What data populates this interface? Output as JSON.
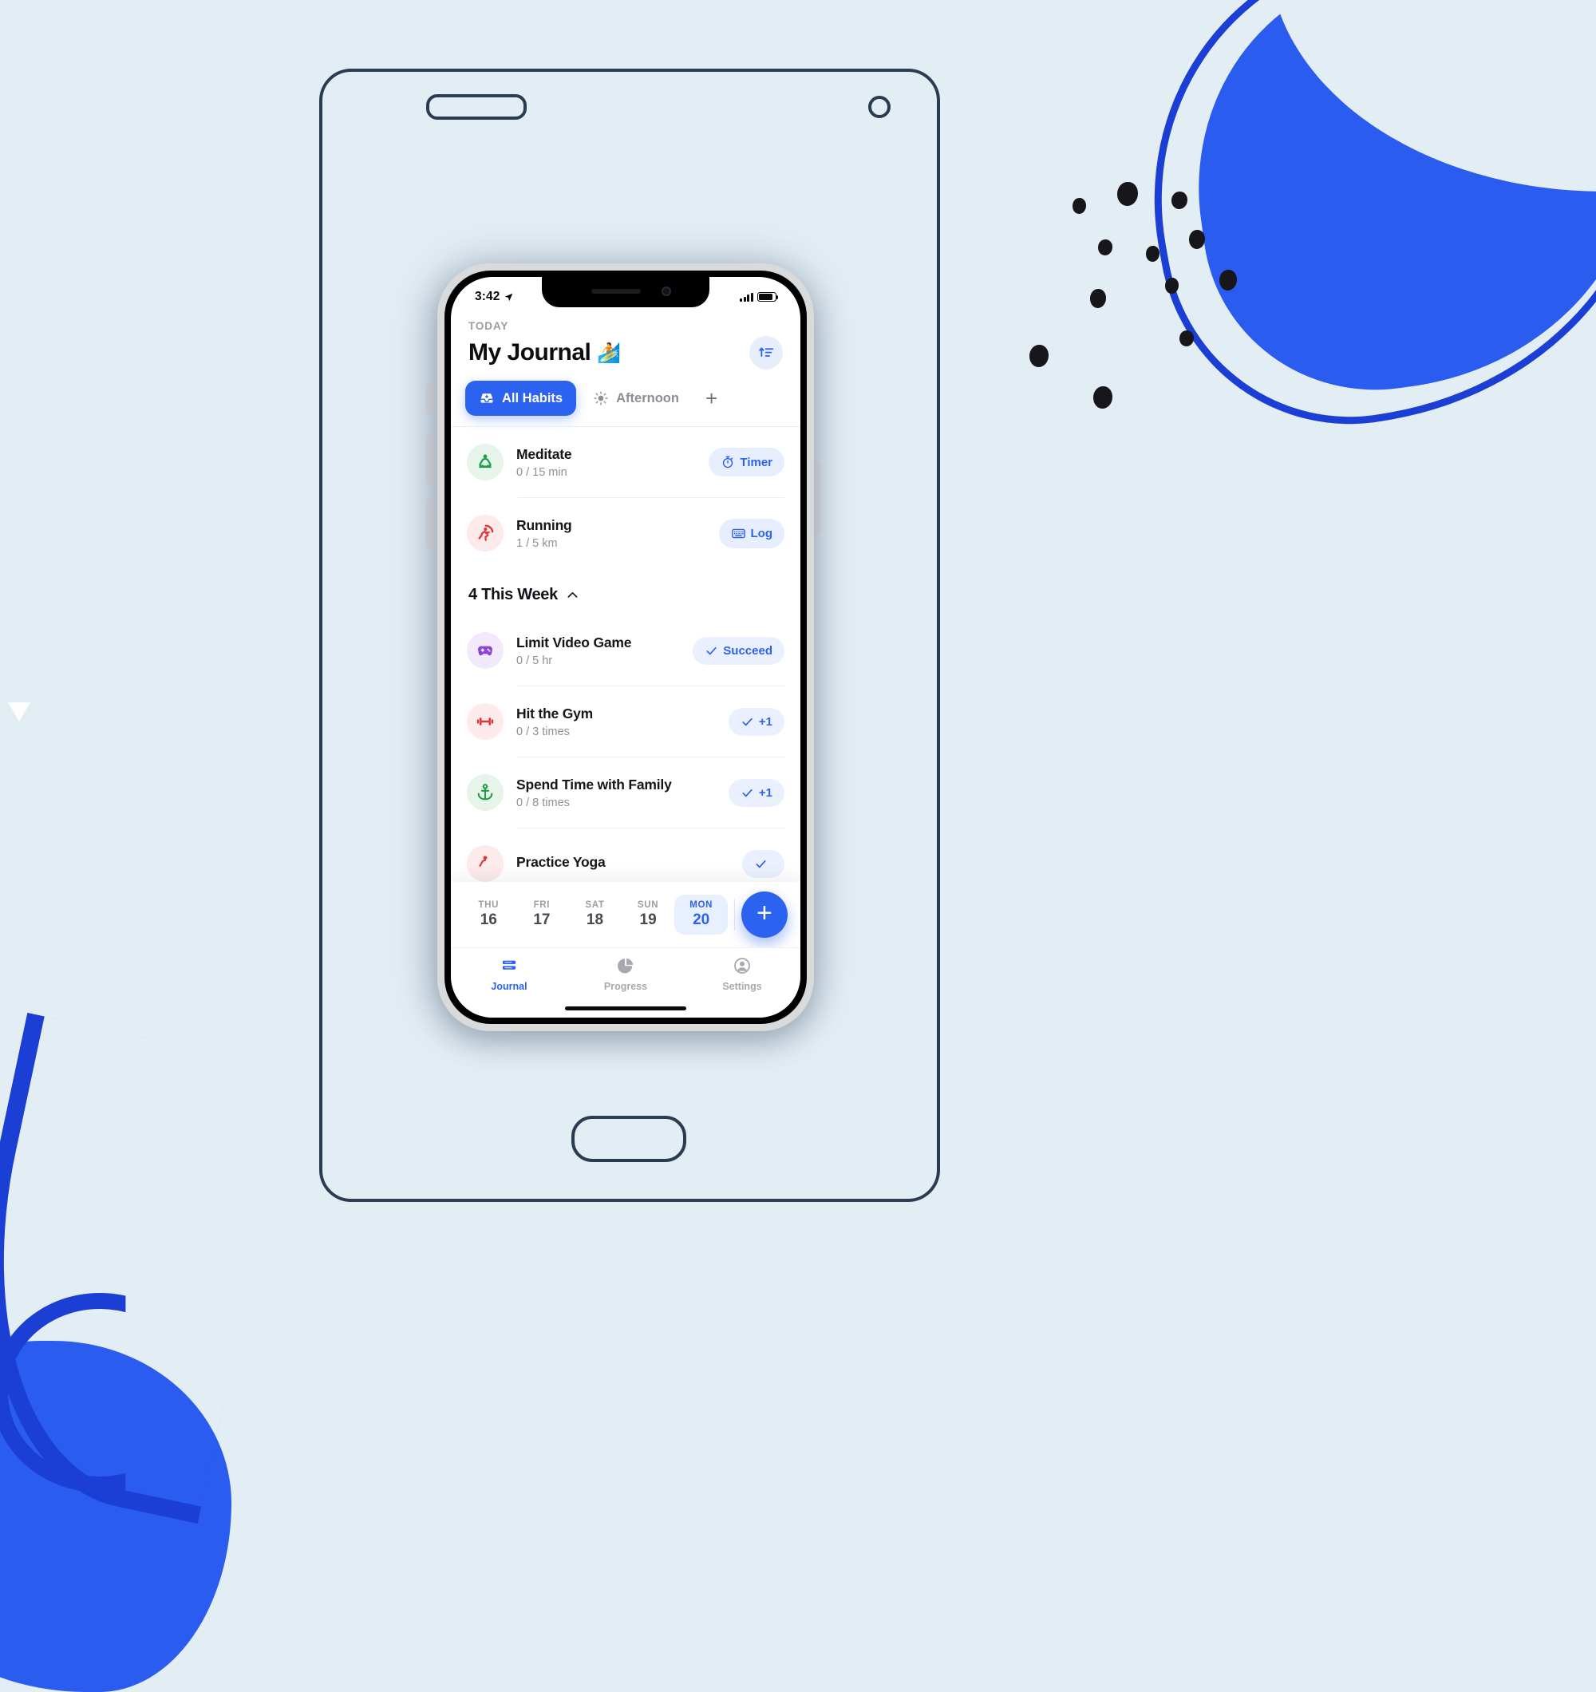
{
  "status_bar": {
    "time": "3:42",
    "location_icon": "location-arrow-icon",
    "signal_icon": "cellular-bars-icon",
    "battery_icon": "battery-icon"
  },
  "header": {
    "eyebrow": "TODAY",
    "title": "My Journal",
    "title_emoji": "🏄",
    "sort_button_icon": "sort-ascending-icon"
  },
  "filter_tabs": {
    "items": [
      {
        "label": "All Habits",
        "icon": "inbox-tray-icon",
        "active": true
      },
      {
        "label": "Afternoon",
        "icon": "sun-icon",
        "active": false
      }
    ],
    "add_tab_label": "+"
  },
  "habits_today": [
    {
      "name": "Meditate",
      "progress": "0 / 15 min",
      "icon": "meditation-icon",
      "icon_color": "#1f9d46",
      "icon_bg": "#e6f4ea",
      "action": {
        "label": "Timer",
        "icon": "stopwatch-icon"
      }
    },
    {
      "name": "Running",
      "progress": "1 / 5 km",
      "icon": "running-icon",
      "icon_color": "#e0363b",
      "icon_bg": "#fdeaea",
      "action": {
        "label": "Log",
        "icon": "keyboard-icon"
      }
    }
  ],
  "week_section": {
    "title": "4 This Week",
    "collapse_icon": "chevron-up-icon"
  },
  "habits_week": [
    {
      "name": "Limit Video Game",
      "progress": "0 / 5 hr",
      "icon": "game-controller-icon",
      "icon_color": "#8b44d6",
      "icon_bg": "#f3e9fd",
      "action": {
        "label": "Succeed",
        "icon": "check-icon"
      }
    },
    {
      "name": "Hit the Gym",
      "progress": "0 / 3 times",
      "icon": "dumbbell-icon",
      "icon_color": "#e0363b",
      "icon_bg": "#fdeaea",
      "action": {
        "label": "+1",
        "icon": "check-icon"
      }
    },
    {
      "name": "Spend Time with Family",
      "progress": "0 / 8 times",
      "icon": "anchor-icon",
      "icon_color": "#1f9d46",
      "icon_bg": "#e6f4ea",
      "action": {
        "label": "+1",
        "icon": "check-icon"
      }
    },
    {
      "name": "Practice Yoga",
      "progress": "",
      "icon": "yoga-icon",
      "icon_color": "#e0363b",
      "icon_bg": "#fdeaea",
      "action": {
        "label": "",
        "icon": "check-icon"
      }
    }
  ],
  "date_bar": {
    "days": [
      {
        "name": "THU",
        "num": "16",
        "selected": false
      },
      {
        "name": "FRI",
        "num": "17",
        "selected": false
      },
      {
        "name": "SAT",
        "num": "18",
        "selected": false
      },
      {
        "name": "SUN",
        "num": "19",
        "selected": false
      },
      {
        "name": "MON",
        "num": "20",
        "selected": true
      }
    ],
    "add_button_label": "+"
  },
  "tab_bar": {
    "items": [
      {
        "label": "Journal",
        "icon": "journal-lines-icon",
        "active": true
      },
      {
        "label": "Progress",
        "icon": "pie-chart-icon",
        "active": false
      },
      {
        "label": "Settings",
        "icon": "person-circle-icon",
        "active": false
      }
    ]
  },
  "theme": {
    "accent": "#2b62f0",
    "accent_soft": "#e7eefd",
    "page_bg": "#e3edf4",
    "ink": "#14161a",
    "muted": "#8e9197"
  }
}
